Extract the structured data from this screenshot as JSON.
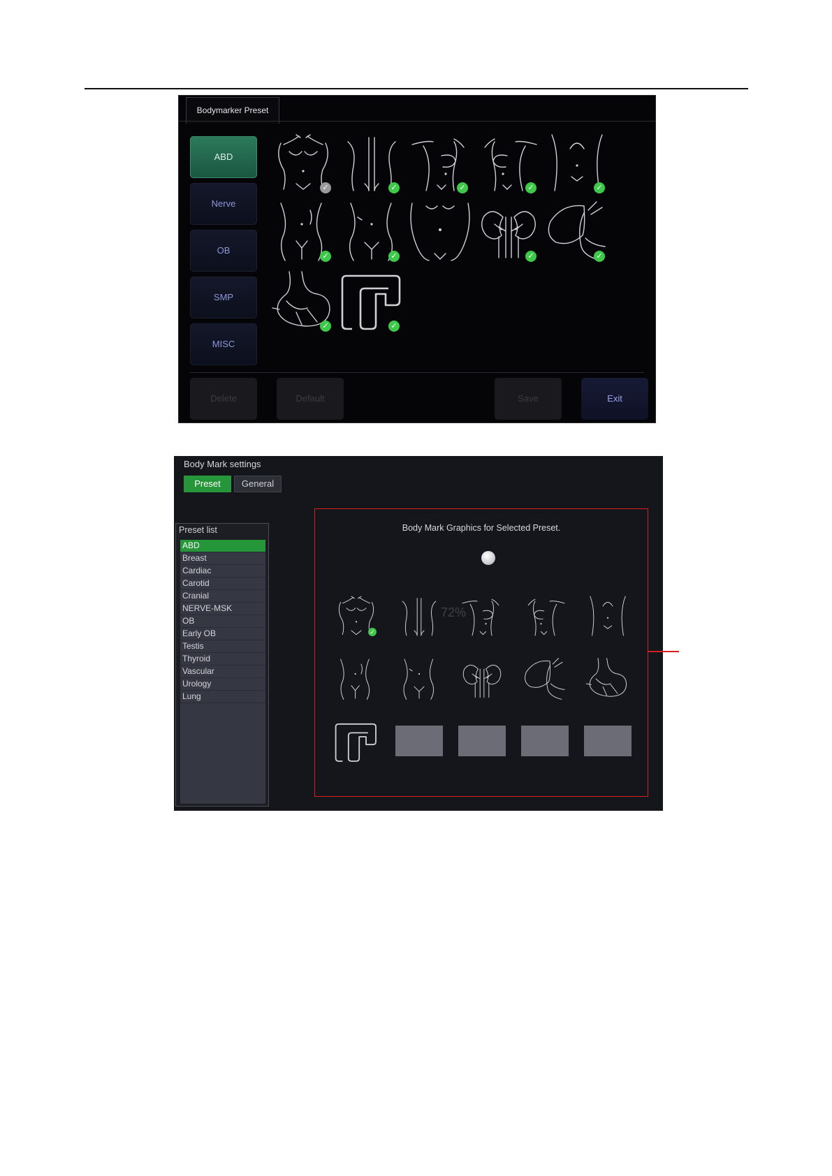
{
  "panel1": {
    "tab_title": "Bodymarker Preset",
    "categories": [
      {
        "label": "ABD",
        "active": true
      },
      {
        "label": "Nerve",
        "active": false
      },
      {
        "label": "OB",
        "active": false
      },
      {
        "label": "SMP",
        "active": false
      },
      {
        "label": "MISC",
        "active": false
      }
    ],
    "buttons": {
      "delete": "Delete",
      "default": "Default",
      "save": "Save",
      "exit": "Exit"
    },
    "colors": {
      "active_green": "#2d7a5c",
      "check_green": "#3fc94a",
      "exit_text": "#9aa2e6"
    },
    "markers": [
      {
        "icon": "torso-front-icon",
        "checked": true,
        "check_color": "grey"
      },
      {
        "icon": "torso-back-icon",
        "checked": true,
        "check_color": "green"
      },
      {
        "icon": "torso-breast-right-icon",
        "checked": true,
        "check_color": "green"
      },
      {
        "icon": "torso-breast-left-icon",
        "checked": true,
        "check_color": "green"
      },
      {
        "icon": "abdomen-icon",
        "checked": true,
        "check_color": "green"
      },
      {
        "icon": "pelvis-male-icon",
        "checked": true,
        "check_color": "green"
      },
      {
        "icon": "pelvis-female-icon",
        "checked": true,
        "check_color": "green"
      },
      {
        "icon": "pregnant-abdomen-icon",
        "checked": false,
        "check_color": "none"
      },
      {
        "icon": "kidneys-icon",
        "checked": true,
        "check_color": "green"
      },
      {
        "icon": "liver-icon",
        "checked": true,
        "check_color": "green"
      },
      {
        "icon": "stomach-icon",
        "checked": true,
        "check_color": "green"
      },
      {
        "icon": "colon-icon",
        "checked": true,
        "check_color": "green"
      }
    ]
  },
  "panel2": {
    "title": "Body Mark settings",
    "tabs": [
      {
        "label": "Preset",
        "active": true
      },
      {
        "label": "General",
        "active": false
      }
    ],
    "preset_list_title": "Preset list",
    "preset_list": [
      "ABD",
      "Breast",
      "Cardiac",
      "Carotid",
      "Cranial",
      "NERVE-MSK",
      "OB",
      "Early OB",
      "Testis",
      "Thyroid",
      "Vascular",
      "Urology",
      "Lung"
    ],
    "selected_preset": "ABD",
    "graphics_title": "Body Mark Graphics for Selected Preset.",
    "progress_text": "72%",
    "graphics": [
      {
        "icon": "torso-front-icon",
        "checked": true
      },
      {
        "icon": "torso-back-icon",
        "checked": false
      },
      {
        "icon": "torso-breast-right-icon",
        "checked": false
      },
      {
        "icon": "torso-breast-left-icon",
        "checked": false
      },
      {
        "icon": "abdomen-icon",
        "checked": false
      },
      {
        "icon": "pelvis-male-icon",
        "checked": false
      },
      {
        "icon": "pelvis-female-icon",
        "checked": false
      },
      {
        "icon": "kidneys-icon",
        "checked": false
      },
      {
        "icon": "liver-icon",
        "checked": false
      },
      {
        "icon": "stomach-icon",
        "checked": false
      },
      {
        "icon": "colon-icon",
        "checked": false
      }
    ],
    "empty_slots": 4,
    "colors": {
      "selection_green": "#26963a",
      "highlight_red": "#d82020"
    }
  }
}
